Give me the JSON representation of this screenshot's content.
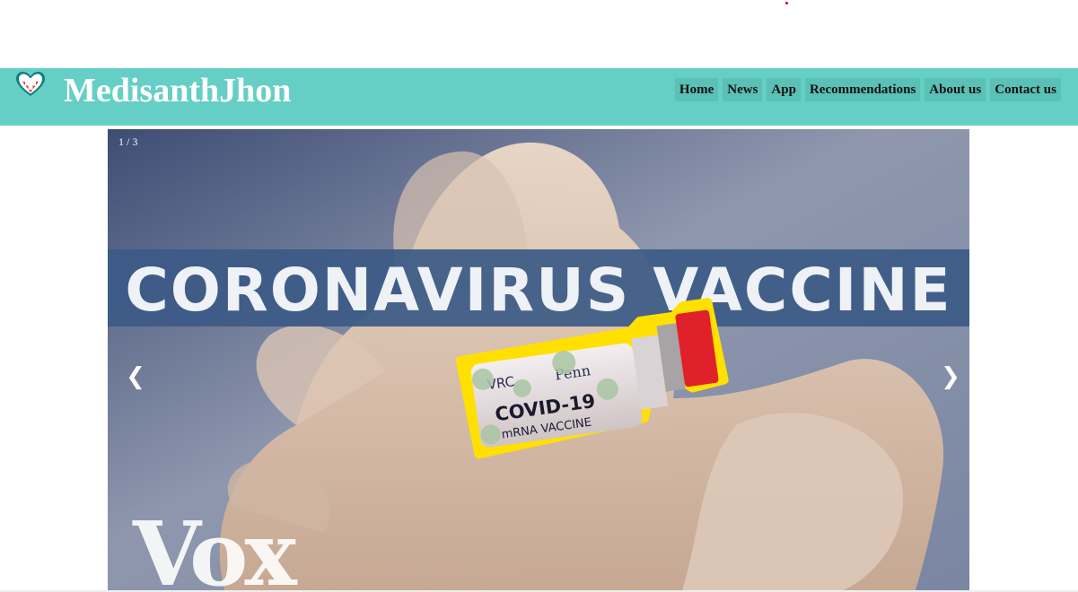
{
  "header": {
    "brand": "MedisanthJhon",
    "logo_icon": "heart-medical-cross-icon"
  },
  "nav": {
    "items": [
      {
        "label": "Home"
      },
      {
        "label": "News"
      },
      {
        "label": "App"
      },
      {
        "label": "Recommendations"
      },
      {
        "label": "About us"
      },
      {
        "label": "Contact us"
      }
    ]
  },
  "slideshow": {
    "counter": "1 / 3",
    "prev_label": "❮",
    "next_label": "❯",
    "slide": {
      "banner_text": "CORONAVIRUS VACCINE",
      "vial_label_brand_left": "VRC",
      "vial_label_brand_right": "Penn",
      "vial_label_main": "COVID-19",
      "vial_label_sub": "mRNA VACCINE",
      "watermark": "Vox"
    }
  },
  "colors": {
    "navbar": "#66cfc5",
    "nav_item_bg": "#5bc0b6",
    "brand_text": "#ffffff",
    "banner": "#3b5a86",
    "vial_outline": "#ffe000",
    "vial_cap": "#e0202a"
  }
}
